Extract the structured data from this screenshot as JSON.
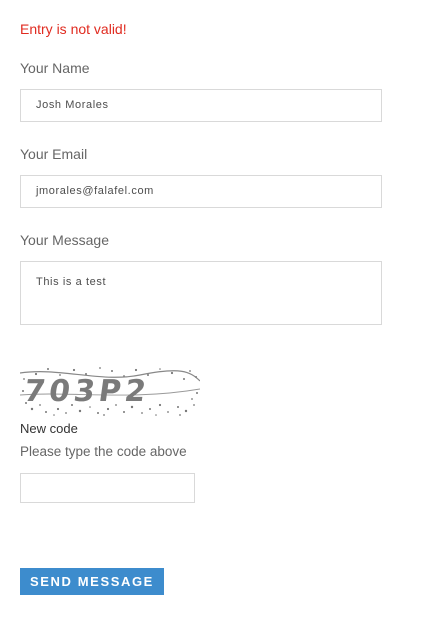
{
  "form": {
    "error_message": "Entry is not valid!",
    "name_label": "Your Name",
    "name_value": "Josh Morales",
    "email_label": "Your Email",
    "email_value": "jmorales@falafel.com",
    "message_label": "Your Message",
    "message_value": "This is a test",
    "captcha_code": "703P2",
    "new_code_label": "New code",
    "captcha_hint": "Please type the code above",
    "captcha_input_value": "",
    "send_label": "SEND MESSAGE"
  },
  "colors": {
    "error": "#e02b20",
    "button": "#3d8ccd",
    "label": "#666666",
    "border": "#d9d9d9"
  }
}
